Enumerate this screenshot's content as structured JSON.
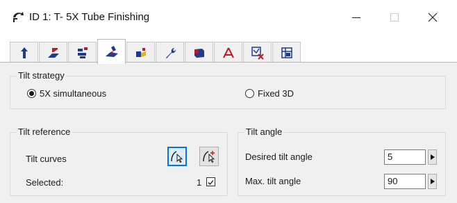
{
  "window": {
    "title": "ID 1: T- 5X Tube Finishing",
    "icons": {
      "app": "operation-icon",
      "minimize": "minimize-icon",
      "maximize": "maximize-icon",
      "close": "close-icon"
    }
  },
  "tabs": [
    {
      "icon": "tool-tab-icon",
      "active": false
    },
    {
      "icon": "geometry-tab-icon",
      "active": false
    },
    {
      "icon": "parameters-tab-icon",
      "active": false
    },
    {
      "icon": "tilt-tab-icon",
      "active": true
    },
    {
      "icon": "collision-tab-icon",
      "active": false
    },
    {
      "icon": "wrench-tab-icon",
      "active": false
    },
    {
      "icon": "stock-tab-icon",
      "active": false
    },
    {
      "icon": "axes-tab-icon",
      "active": false
    },
    {
      "icon": "filter-tab-icon",
      "active": false
    },
    {
      "icon": "misc-tab-icon",
      "active": false
    }
  ],
  "tilt_strategy": {
    "legend": "Tilt strategy",
    "options": [
      {
        "label": "5X simultaneous",
        "checked": true
      },
      {
        "label": "Fixed 3D",
        "checked": false
      }
    ]
  },
  "tilt_reference": {
    "legend": "Tilt reference",
    "curves_label": "Tilt curves",
    "selected_label": "Selected:",
    "selected_count": "1",
    "selected_checked": true
  },
  "tilt_angle": {
    "legend": "Tilt angle",
    "desired_label": "Desired tilt angle",
    "desired_value": "5",
    "max_label": "Max. tilt angle",
    "max_value": "90"
  },
  "colors": {
    "accent": "#0078d7",
    "panel": "#f0f0f0",
    "tab_blue": "#1e3a8a",
    "tab_red": "#c0182a"
  }
}
